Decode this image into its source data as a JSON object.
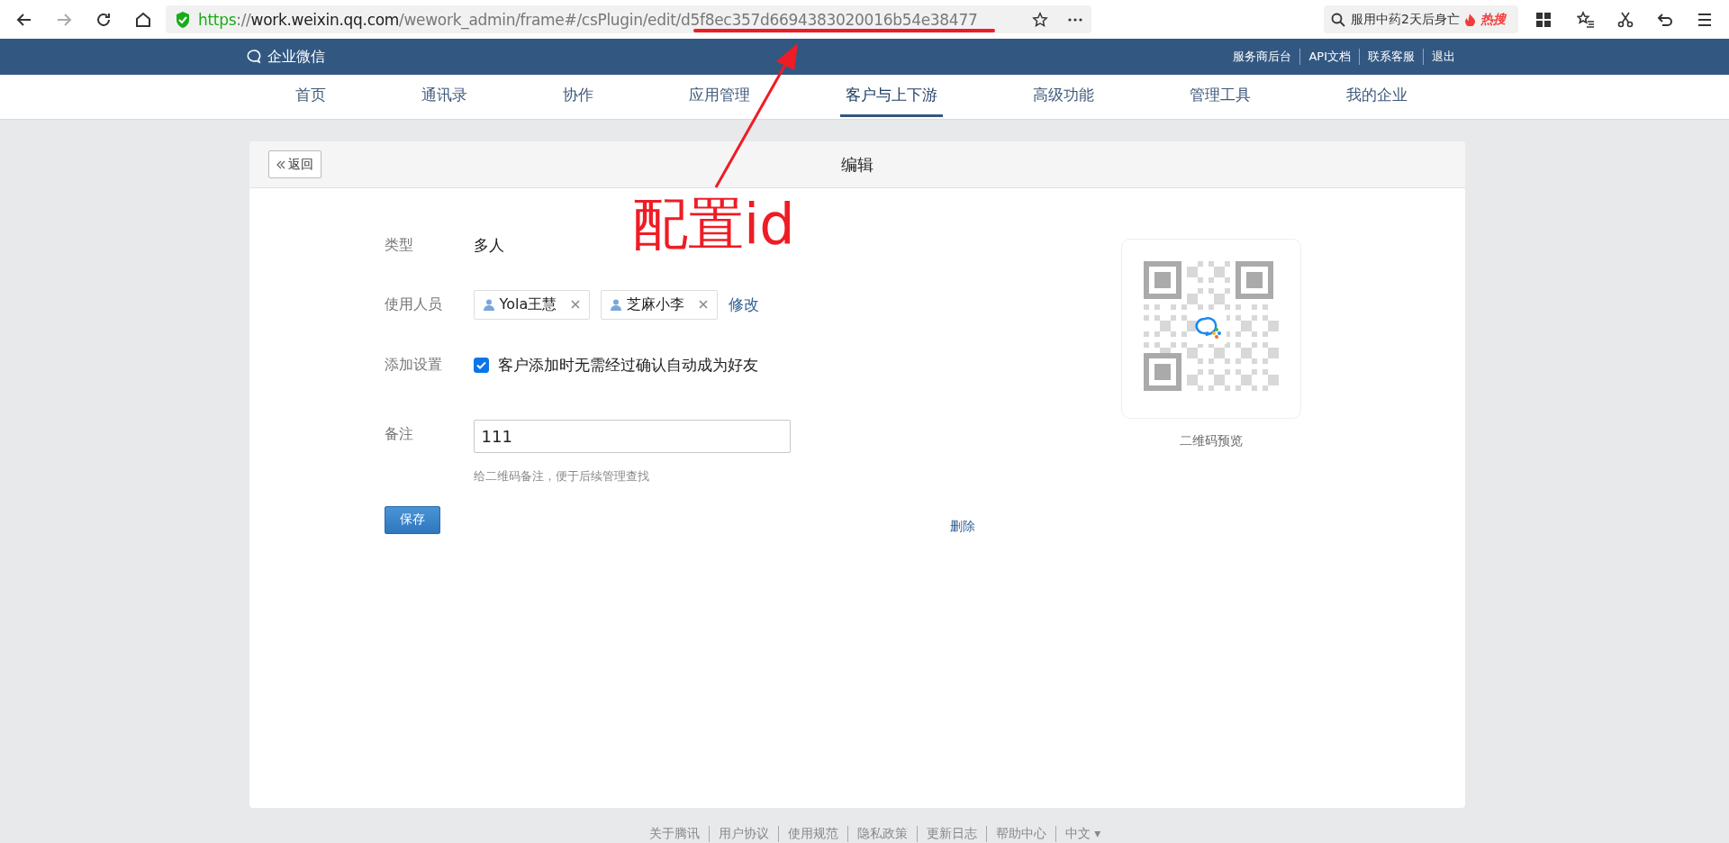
{
  "browser": {
    "url": {
      "scheme": "https",
      "sep": "://",
      "host": "work.weixin.qq.com",
      "path": "/wework_admin/frame#/csPlugin/edit/",
      "id": "d5f8ec357d6694383020016b54e38477"
    },
    "search": {
      "value": "服用中药2天后身亡",
      "badge": "热搜"
    }
  },
  "header": {
    "logo": "企业微信",
    "links": [
      "服务商后台",
      "API文档",
      "联系客服",
      "退出"
    ]
  },
  "nav": [
    {
      "label": "首页",
      "selected": false
    },
    {
      "label": "通讯录",
      "selected": false
    },
    {
      "label": "协作",
      "selected": false
    },
    {
      "label": "应用管理",
      "selected": false
    },
    {
      "label": "客户与上下游",
      "selected": true
    },
    {
      "label": "高级功能",
      "selected": false
    },
    {
      "label": "管理工具",
      "selected": false
    },
    {
      "label": "我的企业",
      "selected": false
    }
  ],
  "card": {
    "back": "返回",
    "title": "编辑"
  },
  "form": {
    "type_label": "类型",
    "type_value": "多人",
    "members_label": "使用人员",
    "members": [
      "Yola王慧",
      "芝麻小李"
    ],
    "edit_link": "修改",
    "setting_label": "添加设置",
    "setting": {
      "label": "客户添加时无需经过确认自动成为好友",
      "checked": true
    },
    "note_label": "备注",
    "note_value": "111",
    "note_hint": "给二维码备注，便于后续管理查找",
    "save": "保存",
    "delete": "删除"
  },
  "qr": {
    "caption": "二维码预览"
  },
  "annotation": {
    "label": "配置id"
  },
  "footer": [
    "关于腾讯",
    "用户协议",
    "使用规范",
    "隐私政策",
    "更新日志",
    "帮助中心",
    "中文 ▾"
  ]
}
